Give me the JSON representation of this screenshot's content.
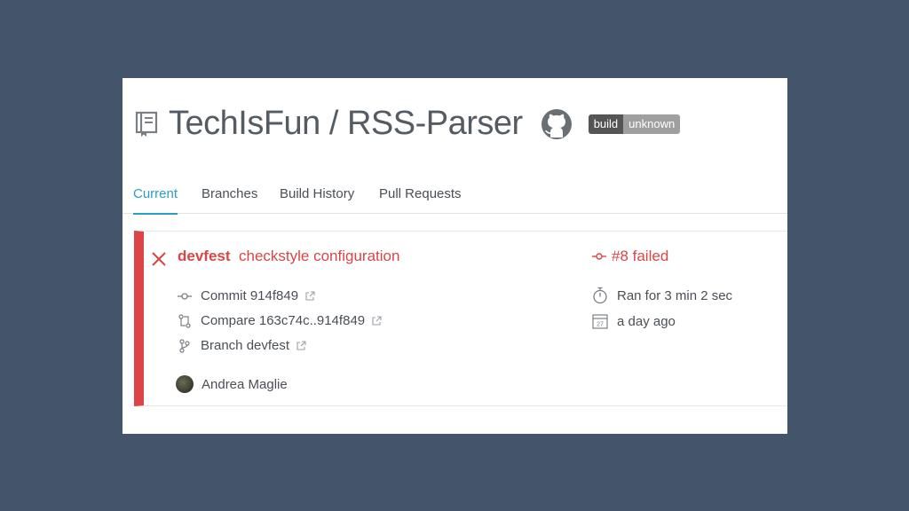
{
  "repo": {
    "title": "TechIsFun / RSS-Parser",
    "badge_left": "build",
    "badge_right": "unknown"
  },
  "tabs": [
    {
      "label": "Current",
      "active": true
    },
    {
      "label": "Branches"
    },
    {
      "label": "Build History"
    },
    {
      "label": "Pull Requests"
    }
  ],
  "build": {
    "branch": "devfest",
    "message": "checkstyle configuration",
    "status": "#8 failed",
    "commit": "Commit 914f849",
    "compare": "Compare 163c74c..914f849",
    "branch_link": "Branch devfest",
    "duration": "Ran for 3 min 2 sec",
    "when": "a day ago",
    "calendar_day": "27",
    "author": "Andrea Maglie"
  },
  "colors": {
    "failed": "#db4545",
    "active_tab": "#2b9ec3",
    "background": "#44546a"
  }
}
